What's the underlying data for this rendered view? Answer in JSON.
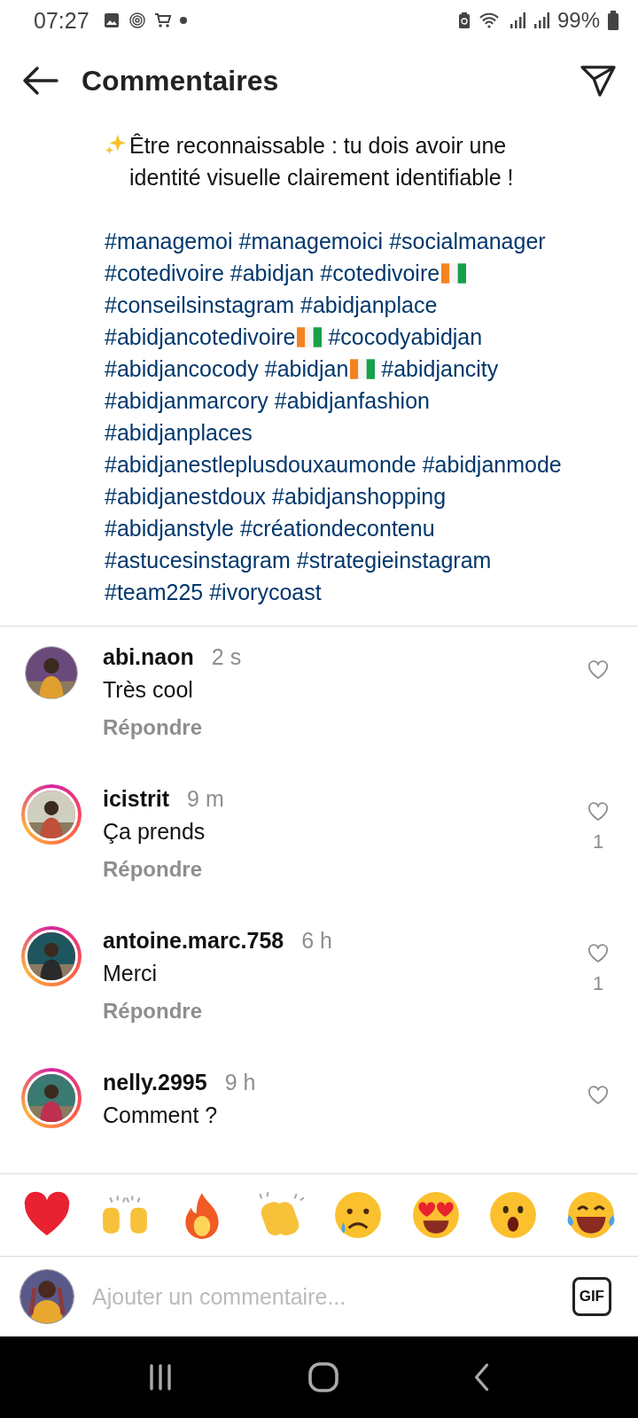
{
  "status_bar": {
    "time": "07:27",
    "battery": "99%"
  },
  "header": {
    "title": "Commentaires"
  },
  "caption": {
    "sparkles": true,
    "text": "Être reconnaissable : tu dois avoir une identité visuelle clairement identifiable !",
    "hashtags": [
      {
        "text": "#managemoi",
        "flag": false
      },
      {
        "text": "#managemoici",
        "flag": false
      },
      {
        "text": "#socialmanager",
        "flag": false
      },
      {
        "text": "#cotedivoire",
        "flag": false
      },
      {
        "text": "#abidjan",
        "flag": false
      },
      {
        "text": "#cotedivoire",
        "flag": true
      },
      {
        "text": "#conseilsinstagram",
        "flag": false
      },
      {
        "text": "#abidjanplace",
        "flag": false
      },
      {
        "text": "#abidjancotedivoire",
        "flag": true
      },
      {
        "text": "#cocodyabidjan",
        "flag": false
      },
      {
        "text": "#abidjancocody",
        "flag": false
      },
      {
        "text": "#abidjan",
        "flag": true
      },
      {
        "text": "#abidjancity",
        "flag": false
      },
      {
        "text": "#abidjanmarcory",
        "flag": false
      },
      {
        "text": "#abidjanfashion",
        "flag": false
      },
      {
        "text": "#abidjanplaces",
        "flag": false
      },
      {
        "text": "#abidjanestleplusdouxaumonde",
        "flag": false
      },
      {
        "text": "#abidjanmode",
        "flag": false
      },
      {
        "text": "#abidjanestdoux",
        "flag": false
      },
      {
        "text": "#abidjanshopping",
        "flag": false
      },
      {
        "text": "#abidjanstyle",
        "flag": false
      },
      {
        "text": "#créationdecontenu",
        "flag": false
      },
      {
        "text": "#astucesinstagram",
        "flag": false
      },
      {
        "text": "#strategieinstagram",
        "flag": false
      },
      {
        "text": "#team225",
        "flag": false
      },
      {
        "text": "#ivorycoast",
        "flag": false
      }
    ]
  },
  "comments": [
    {
      "user": "abi.naon",
      "time": "2 s",
      "text": "Très cool",
      "reply": "Répondre",
      "story_ring": false
    },
    {
      "user": "icistrit",
      "time": "9 m",
      "text": "Ça prends",
      "reply": "Répondre",
      "story_ring": true,
      "likes": "1"
    },
    {
      "user": "antoine.marc.758",
      "time": "6 h",
      "text": "Merci",
      "reply": "Répondre",
      "story_ring": true,
      "likes": "1"
    },
    {
      "user": "nelly.2995",
      "time": "9 h",
      "text": "Comment ?",
      "story_ring": true
    }
  ],
  "reactions": [
    {
      "kind": "heart"
    },
    {
      "kind": "raised-hands"
    },
    {
      "kind": "fire"
    },
    {
      "kind": "clap"
    },
    {
      "kind": "sad"
    },
    {
      "kind": "heart-eyes"
    },
    {
      "kind": "surprised"
    },
    {
      "kind": "laugh"
    }
  ],
  "composer": {
    "placeholder": "Ajouter un commentaire...",
    "gif": "GIF"
  }
}
